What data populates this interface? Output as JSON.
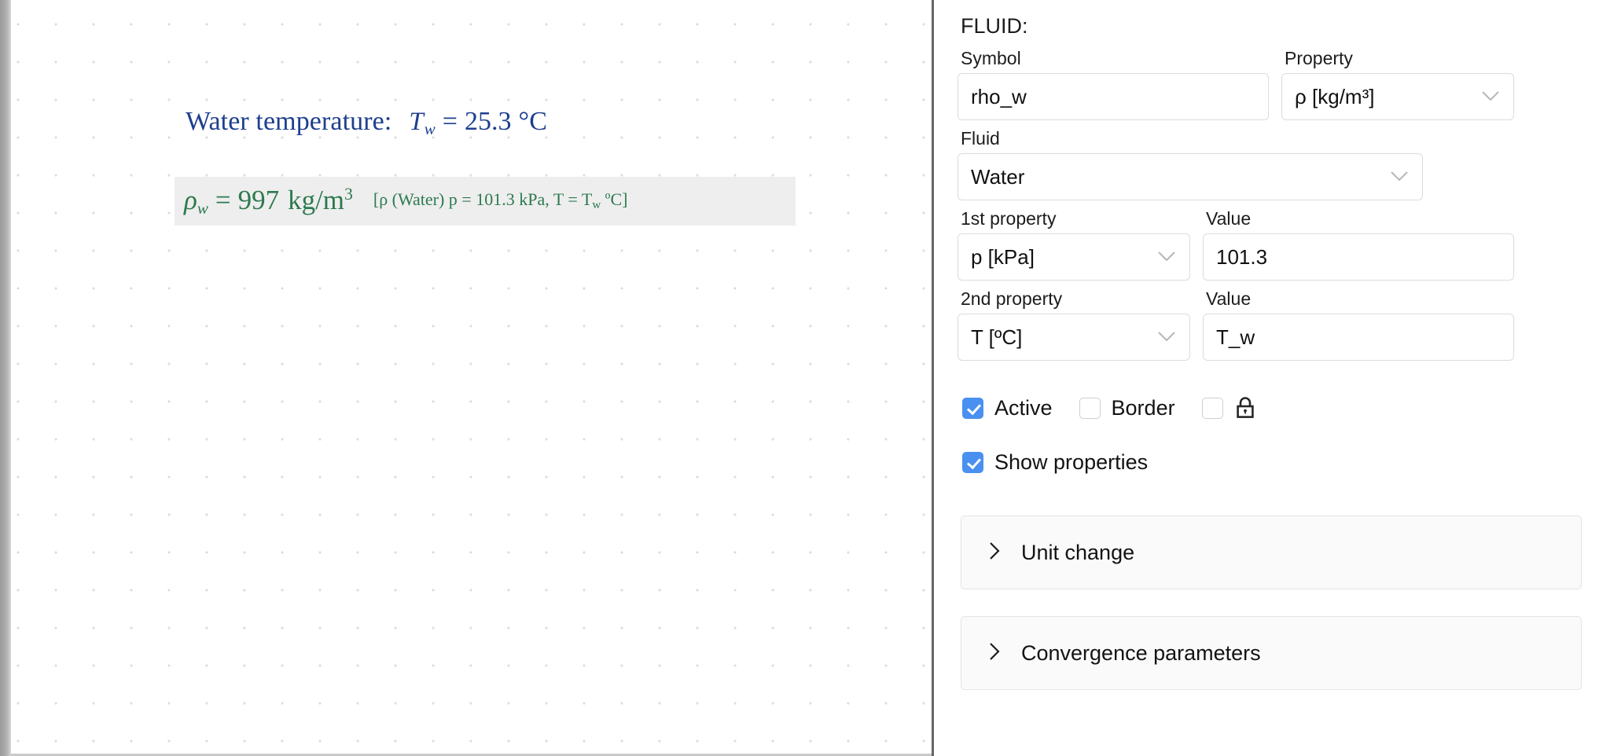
{
  "canvas": {
    "heading": {
      "label": "Water temperature:",
      "variable": "T",
      "subscript": "w",
      "equals": "=",
      "value": "25.3",
      "unit": "°C"
    },
    "result": {
      "symbol": "ρ",
      "subscript": "w",
      "equals": "=",
      "value": "997",
      "unit": "kg/m",
      "unit_exp": "3",
      "note_open": "[ρ (Water) p = 101.3 kPa, T = T",
      "note_sub": "w",
      "note_close": " ºC]",
      "note_full": "[ρ (Water) p = 101.3 kPa, T = T_w ºC]"
    },
    "colors": {
      "heading": "#1d3f8f",
      "result": "#2d7a4f",
      "band_background": "#eeeeee",
      "dot_grid": "#dddddd"
    }
  },
  "panel": {
    "title": "FLUID:",
    "fields": {
      "symbol": {
        "label": "Symbol",
        "value": "rho_w"
      },
      "property": {
        "label": "Property",
        "value": "ρ [kg/m³]",
        "chevron": "chevron-down-icon"
      },
      "fluid": {
        "label": "Fluid",
        "value": "Water",
        "chevron": "chevron-down-icon"
      },
      "first_property": {
        "label": "1st property",
        "value": "p [kPa]",
        "chevron": "chevron-down-icon"
      },
      "first_value": {
        "label": "Value",
        "value": "101.3"
      },
      "second_property": {
        "label": "2nd property",
        "value": "T [ºC]",
        "chevron": "chevron-down-icon"
      },
      "second_value": {
        "label": "Value",
        "value": "T_w"
      }
    },
    "checkboxes": {
      "active": {
        "label": "Active",
        "checked": true
      },
      "border": {
        "label": "Border",
        "checked": false
      },
      "lock": {
        "label": "",
        "checked": false,
        "icon": "lock-icon"
      },
      "show_properties": {
        "label": "Show properties",
        "checked": true
      }
    },
    "accordions": [
      {
        "label": "Unit change",
        "expanded": false,
        "chevron": "chevron-right-icon"
      },
      {
        "label": "Convergence parameters",
        "expanded": false,
        "chevron": "chevron-right-icon"
      }
    ],
    "colors": {
      "checkbox_accent": "#4a90f0",
      "accordion_background": "#fafafa",
      "border": "#dcdcdc"
    }
  }
}
